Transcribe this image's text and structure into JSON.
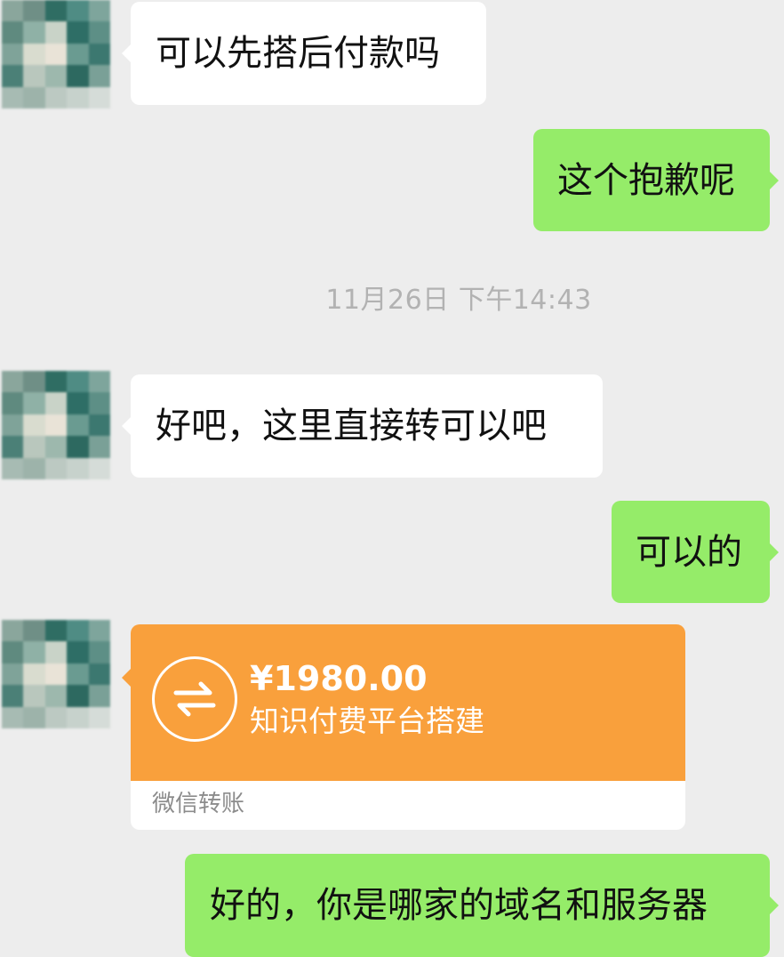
{
  "messages": [
    {
      "direction": "in",
      "text": "可以先搭后付款吗"
    },
    {
      "direction": "out",
      "text": "这个抱歉呢"
    },
    {
      "direction": "in",
      "text": "好吧，这里直接转可以吧"
    },
    {
      "direction": "out",
      "text": "可以的"
    },
    {
      "direction": "out",
      "text": "好的，你是哪家的域名和服务器"
    }
  ],
  "timestamp": "11月26日 下午14:43",
  "transfer": {
    "amount": "¥1980.00",
    "note": "知识付费平台搭建",
    "footer": "微信转账",
    "icon": "transfer-arrows-icon"
  },
  "colors": {
    "background": "#ededed",
    "incoming_bubble": "#ffffff",
    "outgoing_bubble": "#95ec69",
    "transfer_orange": "#f9a03c",
    "timestamp_text": "#b2b2b2"
  }
}
